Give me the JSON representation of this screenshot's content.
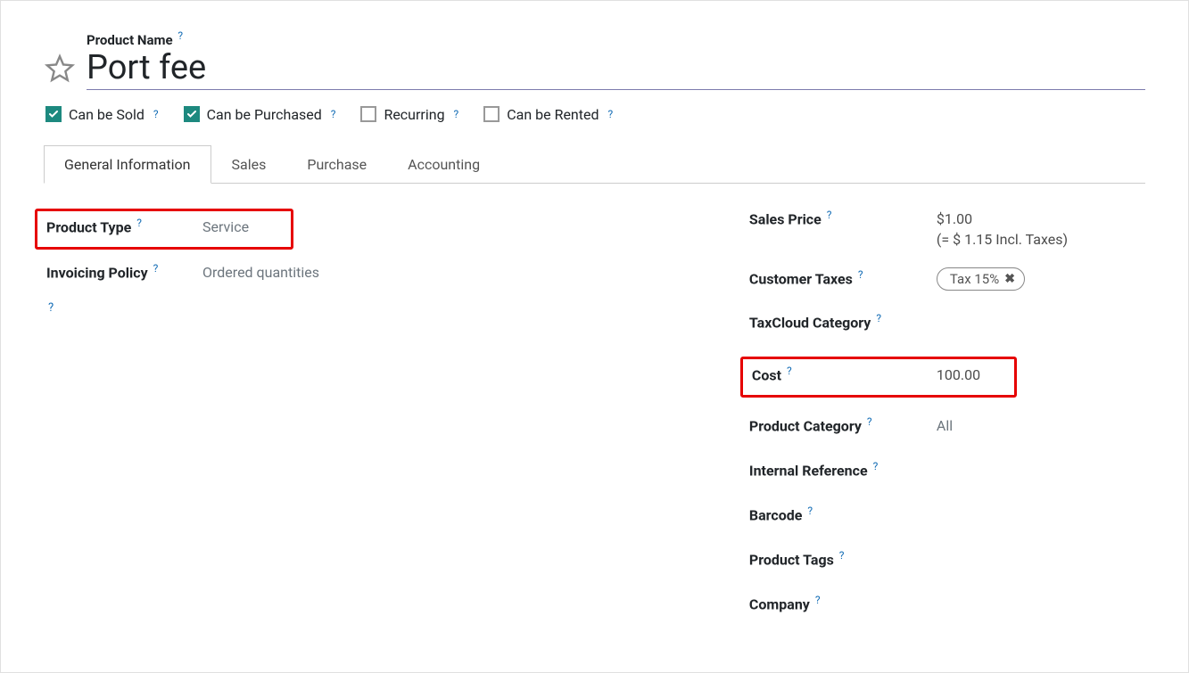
{
  "title_label": "Product Name",
  "product_name": "Port fee",
  "check_items": [
    {
      "label": "Can be Sold",
      "checked": true
    },
    {
      "label": "Can be Purchased",
      "checked": true
    },
    {
      "label": "Recurring",
      "checked": false
    },
    {
      "label": "Can be Rented",
      "checked": false
    }
  ],
  "tabs": [
    "General Information",
    "Sales",
    "Purchase",
    "Accounting"
  ],
  "left_fields": {
    "product_type": {
      "label": "Product Type",
      "value": "Service"
    },
    "invoicing_policy": {
      "label": "Invoicing Policy",
      "value": "Ordered quantities"
    }
  },
  "right_fields": {
    "sales_price": {
      "label": "Sales Price",
      "value": "$1.00",
      "note": "(= $ 1.15 Incl. Taxes)"
    },
    "customer_taxes": {
      "label": "Customer Taxes",
      "tag": "Tax 15%"
    },
    "taxcloud_category": {
      "label": "TaxCloud Category",
      "value": ""
    },
    "cost": {
      "label": "Cost",
      "value": "100.00"
    },
    "product_category": {
      "label": "Product Category",
      "value": "All"
    },
    "internal_reference": {
      "label": "Internal Reference",
      "value": ""
    },
    "barcode": {
      "label": "Barcode",
      "value": ""
    },
    "product_tags": {
      "label": "Product Tags",
      "value": ""
    },
    "company": {
      "label": "Company",
      "value": ""
    }
  },
  "help_symbol": "?",
  "tag_close": "✖"
}
